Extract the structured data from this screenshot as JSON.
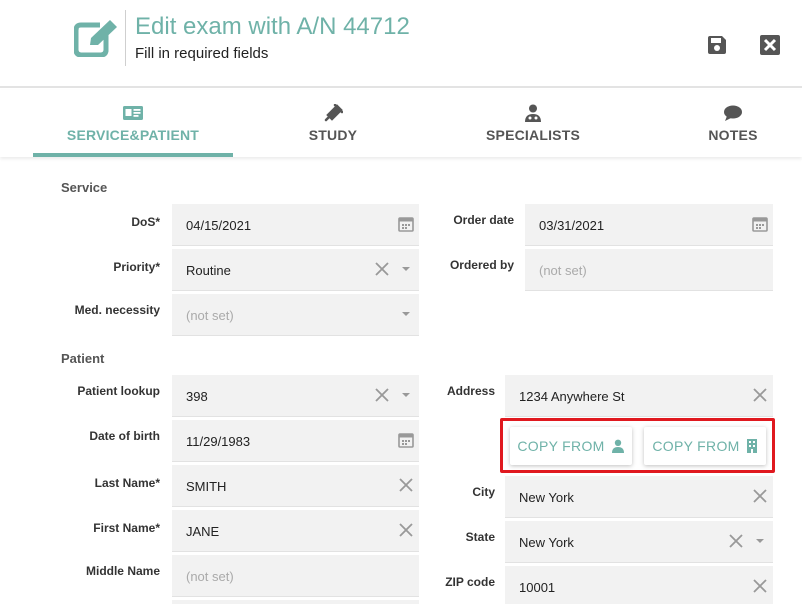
{
  "header": {
    "title": "Edit exam with A/N 44712",
    "subtitle": "Fill in required fields"
  },
  "tabs": [
    {
      "label": "SERVICE&PATIENT",
      "icon": "id-card-icon",
      "active": true
    },
    {
      "label": "STUDY",
      "icon": "syringe-icon",
      "active": false
    },
    {
      "label": "SPECIALISTS",
      "icon": "user-md-icon",
      "active": false
    },
    {
      "label": "NOTES",
      "icon": "comment-icon",
      "active": false
    }
  ],
  "service": {
    "section_title": "Service",
    "dos": {
      "label": "DoS*",
      "value": "04/15/2021"
    },
    "order_date": {
      "label": "Order date",
      "value": "03/31/2021"
    },
    "priority": {
      "label": "Priority*",
      "value": "Routine"
    },
    "ordered_by": {
      "label": "Ordered by",
      "placeholder": "(not set)"
    },
    "med_necessity": {
      "label": "Med. necessity",
      "placeholder": "(not set)"
    }
  },
  "patient": {
    "section_title": "Patient",
    "lookup": {
      "label": "Patient lookup",
      "value": "398"
    },
    "dob": {
      "label": "Date of birth",
      "value": "11/29/1983"
    },
    "last_name": {
      "label": "Last Name*",
      "value": "SMITH"
    },
    "first_name": {
      "label": "First Name*",
      "value": "JANE"
    },
    "middle_name": {
      "label": "Middle Name",
      "placeholder": "(not set)"
    },
    "address": {
      "label": "Address",
      "value": "1234 Anywhere St"
    },
    "copy_from_patient": {
      "label": "COPY FROM",
      "icon": "user-icon"
    },
    "copy_from_facility": {
      "label": "COPY FROM",
      "icon": "building-icon"
    },
    "city": {
      "label": "City",
      "value": "New York"
    },
    "state": {
      "label": "State",
      "value": "New York"
    },
    "zip": {
      "label": "ZIP code",
      "value": "10001"
    }
  },
  "colors": {
    "accent": "#6fb2a8",
    "highlight": "#e0191f",
    "field_bg": "#f2f2f2"
  }
}
